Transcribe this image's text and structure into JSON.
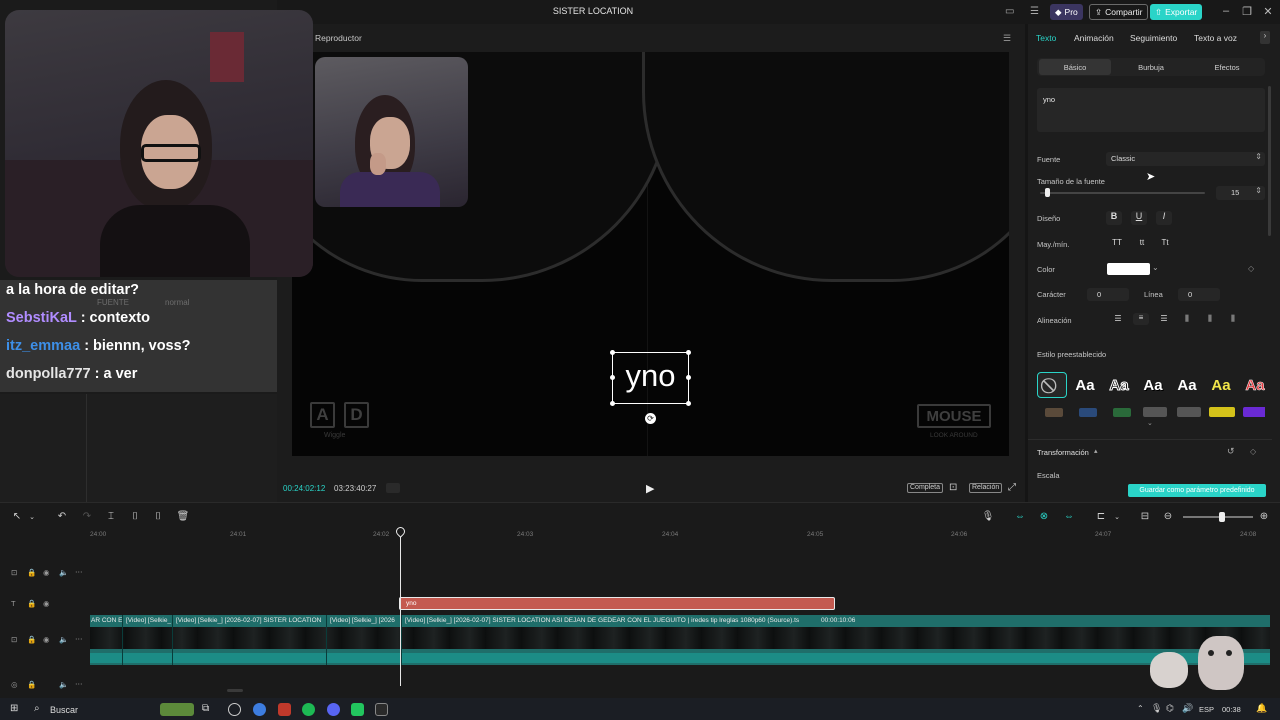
{
  "app": {
    "title": "SISTER LOCATION",
    "pro_label": "Pro",
    "share_label": "Compartir",
    "export_label": "Exportar"
  },
  "player": {
    "label": "Reproductor",
    "overlay_text": "yno",
    "timecode_current": "00:24:02:12",
    "timecode_total": "03:23:40:27",
    "full_label": "Completa",
    "ratio_label": "Relación",
    "hud_keys": [
      "A",
      "D"
    ],
    "hud_keys_caption": "Wiggle",
    "hud_mouse": "MOUSE",
    "hud_mouse_caption": "LOOK AROUND"
  },
  "chat": {
    "partial_line": "a la hora de editar?",
    "ghost_labels": [
      "FUENTE",
      "normal"
    ],
    "messages": [
      {
        "user": "SebstiKaL",
        "color": "#b08cff",
        "text": ": contexto"
      },
      {
        "user": "itz_emmaa",
        "color": "#3d8fe8",
        "text": ": biennn, voss?"
      },
      {
        "user": "donpolla777",
        "color": "#e6e6e6",
        "text": ": a ver"
      }
    ]
  },
  "panel": {
    "tabs": [
      "Texto",
      "Animación",
      "Seguimiento",
      "Texto a voz"
    ],
    "subtabs": [
      "Básico",
      "Burbuja",
      "Efectos"
    ],
    "text_value": "yno",
    "font_label": "Fuente",
    "font_value": "Classic",
    "size_label": "Tamaño de la fuente",
    "size_value": "15",
    "size_fraction": 0.05,
    "style_label": "Diseño",
    "style_buttons": [
      "B",
      "U",
      "I"
    ],
    "case_label": "May./mín.",
    "case_buttons": [
      "TT",
      "tt",
      "Tt"
    ],
    "color_label": "Color",
    "color_value": "#ffffff",
    "char_label": "Carácter",
    "char_value": "0",
    "line_label": "Línea",
    "line_value": "0",
    "align_label": "Alineación",
    "preset_label": "Estilo preestablecido",
    "preset_sample": "Aa",
    "transform_label": "Transformación",
    "scale_label": "Escala",
    "save_preset_label": "Guardar como parámetro predefinido"
  },
  "timeline": {
    "ruler": [
      "24:00",
      "24:01",
      "24:02",
      "24:03",
      "24:04",
      "24:05",
      "24:06",
      "24:07",
      "24:08"
    ],
    "text_clip_label": "yno",
    "video_clip_labels": [
      "AR CON E",
      "[Video] [Selkie_",
      "[Video] [Selkie_] [2026-02-07] SISTER LOCATION",
      "[Video] [Selkie_] [2026",
      "[Video] [Selkie_] [2026-02-07] SISTER LOCATION ASI DEJAN DE GEDEAR CON EL JUEGUITO  |  iredes tip lreglas 1080p60 (Source).ts"
    ],
    "video_clip_duration": "00:00:10:06"
  },
  "taskbar": {
    "search_placeholder": "Buscar",
    "lang": "ESP",
    "time": "00:38"
  }
}
